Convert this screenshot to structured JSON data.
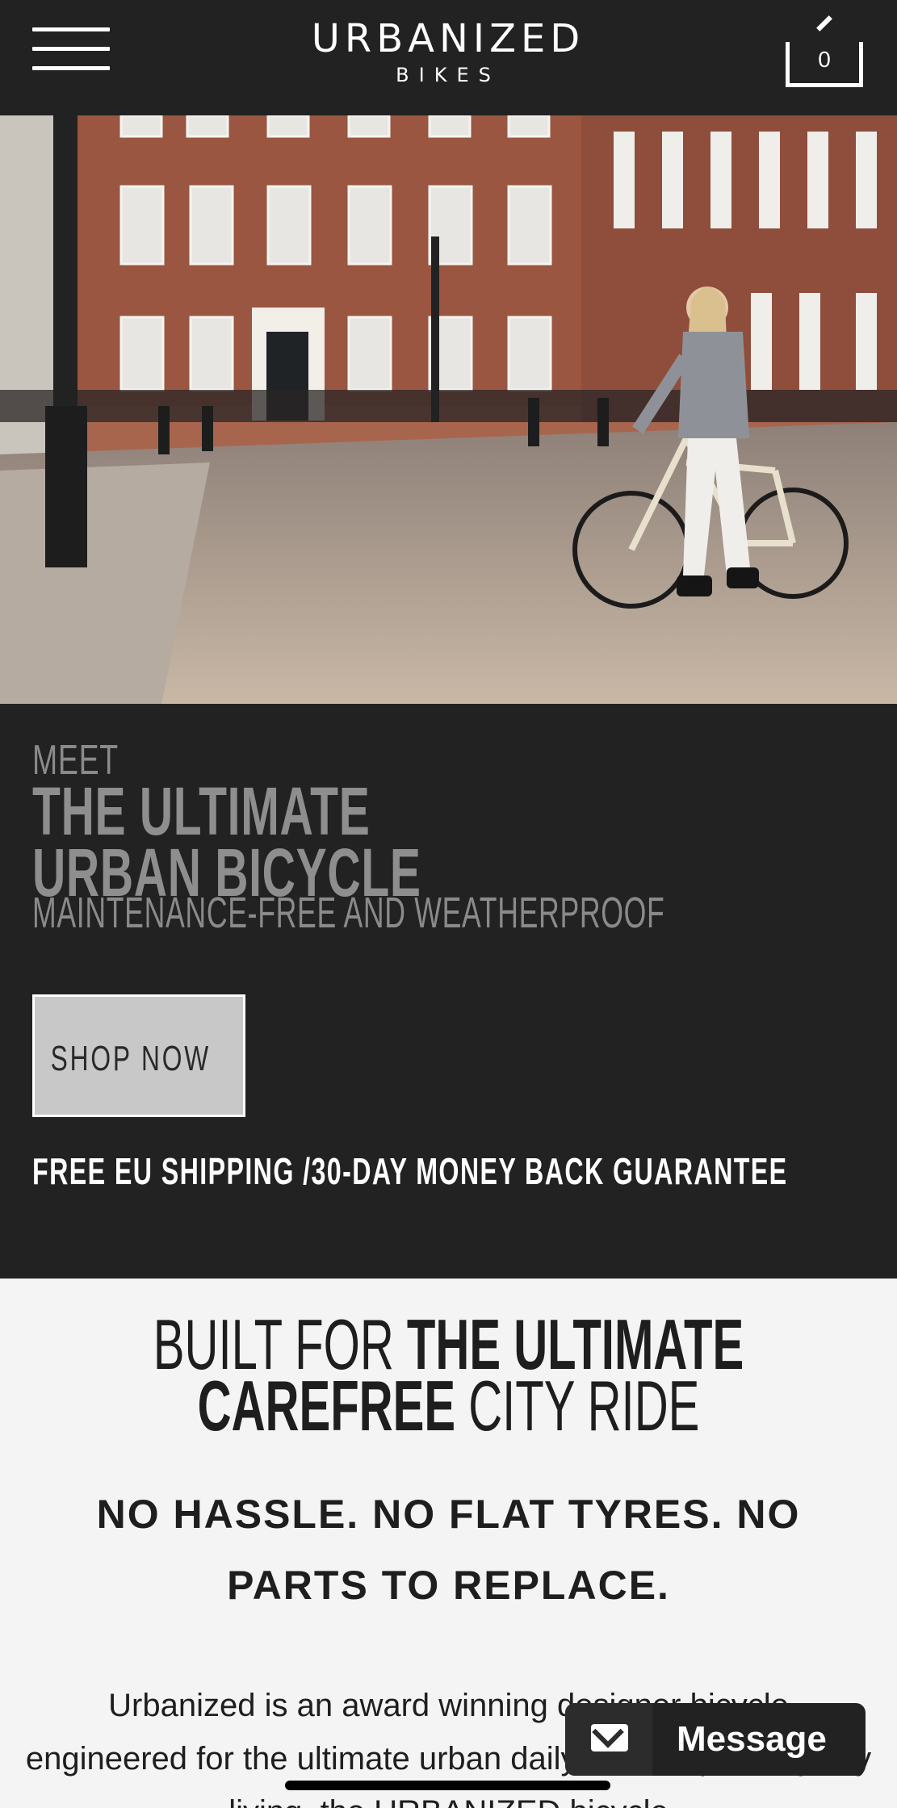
{
  "header": {
    "logo_main": "URBANIZED",
    "logo_sub": "BIKES",
    "cart_count": "0",
    "menu_icon": "hamburger-menu-icon",
    "cart_icon": "shopping-bag-icon"
  },
  "hero": {
    "image": "woman-with-bicycle-city-street"
  },
  "intro": {
    "meet": "MEET",
    "headline_line1": "THE ULTIMATE",
    "headline_line2": "URBAN BICYCLE",
    "tagline": "MAINTENANCE-FREE AND WEATHERPROOF",
    "shop_button": "SHOP NOW",
    "shipping": "FREE EU SHIPPING /30-DAY MONEY BACK GUARANTEE"
  },
  "features": {
    "built_prefix": "BUILT FOR",
    "built_bold1": "THE ULTIMATE",
    "built_bold2": "CAREFREE",
    "built_suffix": "CITY RIDE",
    "hassle": "NO HASSLE. NO FLAT TYRES. NO PARTS TO REPLACE.",
    "paragraph": "Urbanized is an award winning designer bicycle engineered for the ultimate urban daily use. Inspired by city living, the URBANIZED bicycle"
  },
  "message_widget": {
    "label": "Message",
    "icon": "envelope-icon"
  },
  "colors": {
    "header_bg": "#222222",
    "dark_section_bg": "#222222",
    "light_section_bg": "#f4f4f4",
    "button_bg": "#c8c8c8"
  }
}
